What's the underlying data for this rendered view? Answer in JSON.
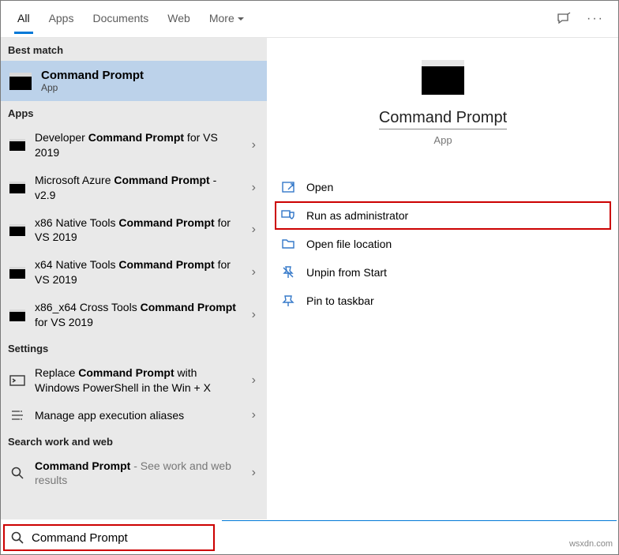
{
  "tabs": {
    "all": "All",
    "apps": "Apps",
    "documents": "Documents",
    "web": "Web",
    "more": "More"
  },
  "sections": {
    "best_match": "Best match",
    "apps": "Apps",
    "settings": "Settings",
    "search_web": "Search work and web"
  },
  "best_match": {
    "title": "Command Prompt",
    "subtitle": "App"
  },
  "apps_list": [
    {
      "pre": "Developer ",
      "bold": "Command Prompt",
      "post": " for VS 2019"
    },
    {
      "pre": "Microsoft Azure ",
      "bold": "Command Prompt",
      "post": " - v2.9"
    },
    {
      "pre": "x86 Native Tools ",
      "bold": "Command Prompt",
      "post": " for VS 2019"
    },
    {
      "pre": "x64 Native Tools ",
      "bold": "Command Prompt",
      "post": " for VS 2019"
    },
    {
      "pre": "x86_x64 Cross Tools ",
      "bold": "Command Prompt",
      "post": " for VS 2019"
    }
  ],
  "settings_list": [
    {
      "pre": "Replace ",
      "bold": "Command Prompt",
      "post": " with Windows PowerShell in the Win + X"
    },
    {
      "pre": "Manage app execution aliases",
      "bold": "",
      "post": ""
    }
  ],
  "web_list": [
    {
      "pre": "",
      "bold": "Command Prompt",
      "post": "",
      "hint": " - See work and web results"
    }
  ],
  "preview": {
    "title": "Command Prompt",
    "subtitle": "App"
  },
  "actions": {
    "open": "Open",
    "run_admin": "Run as administrator",
    "open_loc": "Open file location",
    "unpin": "Unpin from Start",
    "pin_taskbar": "Pin to taskbar"
  },
  "search": {
    "value": "Command Prompt"
  },
  "watermark": "wsxdn.com"
}
